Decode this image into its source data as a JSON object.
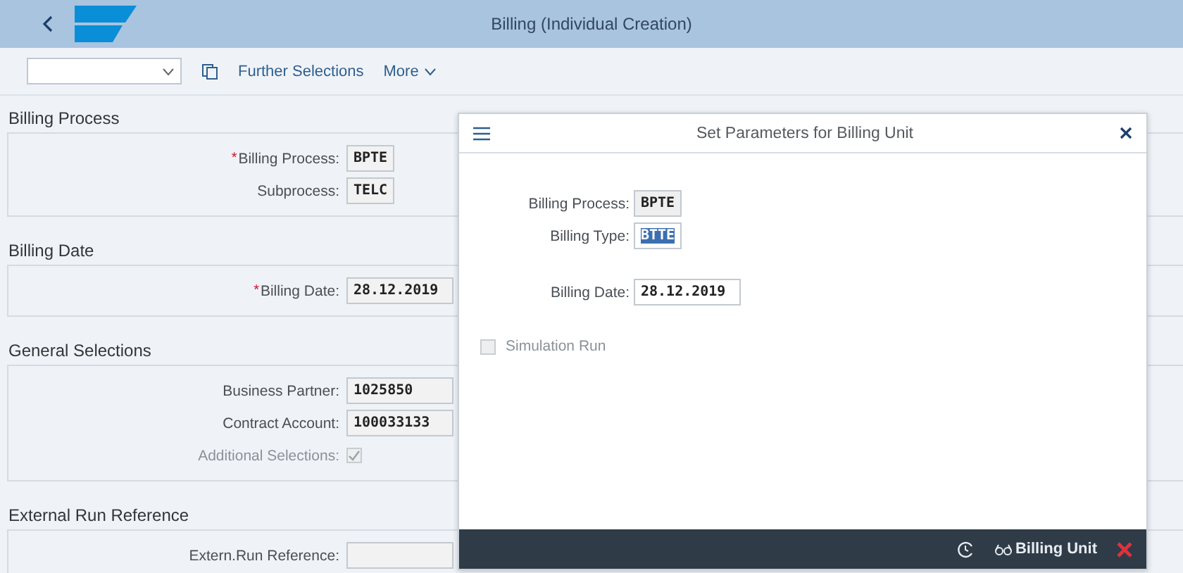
{
  "shell": {
    "title": "Billing (Individual Creation)"
  },
  "toolbar": {
    "items": [
      {
        "kind": "icon"
      },
      {
        "kind": "text",
        "label": "Further Selections"
      },
      {
        "kind": "menu",
        "label": "More"
      }
    ]
  },
  "required_mark": "*",
  "sections": [
    {
      "title": "Billing Process",
      "fields": [
        {
          "kind": "input",
          "label": "Billing Process:",
          "value": "BPTE",
          "required": true
        },
        {
          "kind": "input",
          "label": "Subprocess:",
          "value": "TELC"
        }
      ]
    },
    {
      "title": "Billing Date",
      "fields": [
        {
          "kind": "input",
          "label": "Billing Date:",
          "value": "28.12.2019",
          "required": true
        }
      ]
    },
    {
      "title": "General Selections",
      "fields": [
        {
          "kind": "input",
          "label": "Business Partner:",
          "value": "1025850"
        },
        {
          "kind": "input",
          "label": "Contract Account:",
          "value": "100033133"
        },
        {
          "kind": "checkbox",
          "label": "Additional Selections:",
          "checked": true,
          "disabled": true
        }
      ]
    },
    {
      "title": "External Run Reference",
      "fields": [
        {
          "kind": "input",
          "label": "Extern.Run Reference:"
        }
      ]
    }
  ],
  "dialog": {
    "title": "Set Parameters for Billing Unit",
    "groups": [
      [
        {
          "kind": "input",
          "label": "Billing Process:",
          "value": "BPTE",
          "readonly": true,
          "highlighted": false
        },
        {
          "kind": "input",
          "label": "Billing Type:",
          "value": "BTTE",
          "readonly": false,
          "highlighted": true
        }
      ],
      [
        {
          "kind": "input",
          "label": "Billing Date:",
          "value": "28.12.2019",
          "readonly": false,
          "highlighted": false
        }
      ],
      [
        {
          "kind": "checkbox",
          "label": "Simulation Run",
          "checked": false,
          "disabled": true
        }
      ]
    ],
    "footer": {
      "button_label": "Billing Unit"
    }
  }
}
